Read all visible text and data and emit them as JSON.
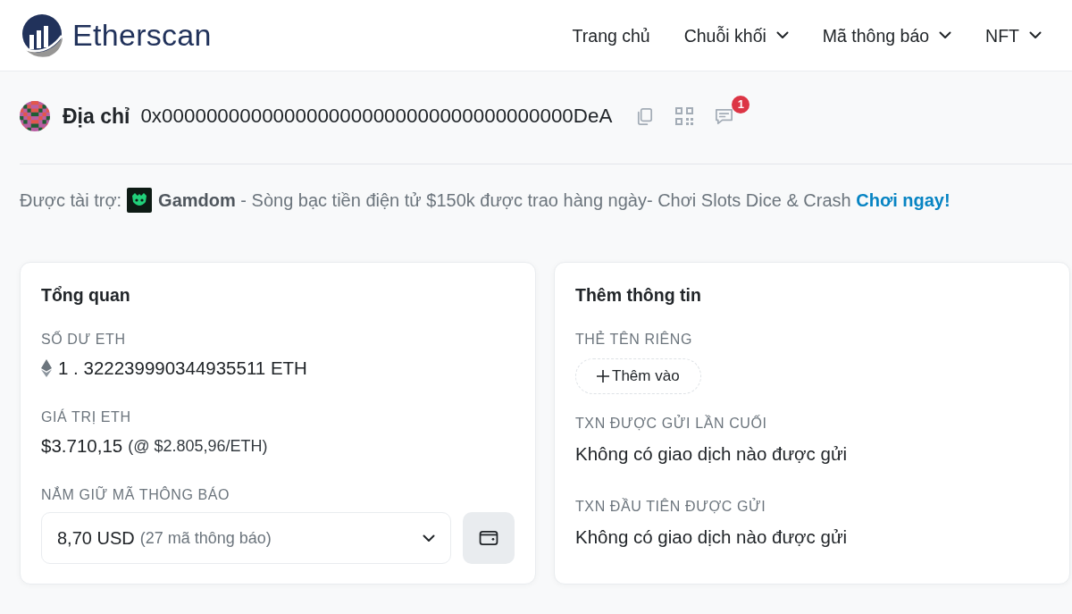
{
  "header": {
    "logo_text": "Etherscan",
    "nav": [
      {
        "label": "Trang chủ",
        "dropdown": false
      },
      {
        "label": "Chuỗi khối",
        "dropdown": true
      },
      {
        "label": "Mã thông báo",
        "dropdown": true
      },
      {
        "label": "NFT",
        "dropdown": true
      }
    ]
  },
  "address_bar": {
    "title": "Địa chỉ",
    "address": "0x0000000000000000000000000000000000000DeA",
    "notification_count": "1"
  },
  "sponsor": {
    "label": "Được tài trợ:",
    "text": "**Gamdom** - Sòng bạc tiền điện tử $150k được trao hàng ngày- Chơi Slots Dice & Crash",
    "link": "Chơi ngay!"
  },
  "overview": {
    "title": "Tổng quan",
    "sections": [
      {
        "kind": "balance",
        "label": "SỐ DƯ ETH",
        "value": "1 . 322239990344935511 ETH"
      },
      {
        "kind": "price",
        "label": "GIÁ TRỊ ETH",
        "value": "$3.710,15",
        "note": "(@ $2.805,96/ETH)"
      },
      {
        "kind": "holdings",
        "label": "NẮM GIỮ MÃ THÔNG BÁO",
        "value": "8,70 USD",
        "note": "(27 mã thông báo)"
      }
    ]
  },
  "more_info": {
    "title": "Thêm thông tin",
    "sections": [
      {
        "kind": "action",
        "label": "THẺ TÊN RIÊNG",
        "button": "Thêm vào"
      },
      {
        "kind": "text",
        "label": "TXN ĐƯỢC GỬI LẦN CUỐI",
        "value": "Không có giao dịch nào được gửi"
      },
      {
        "kind": "text",
        "label": "TXN ĐẦU TIÊN ĐƯỢC GỬI",
        "value": "Không có giao dịch nào được gửi"
      }
    ]
  }
}
